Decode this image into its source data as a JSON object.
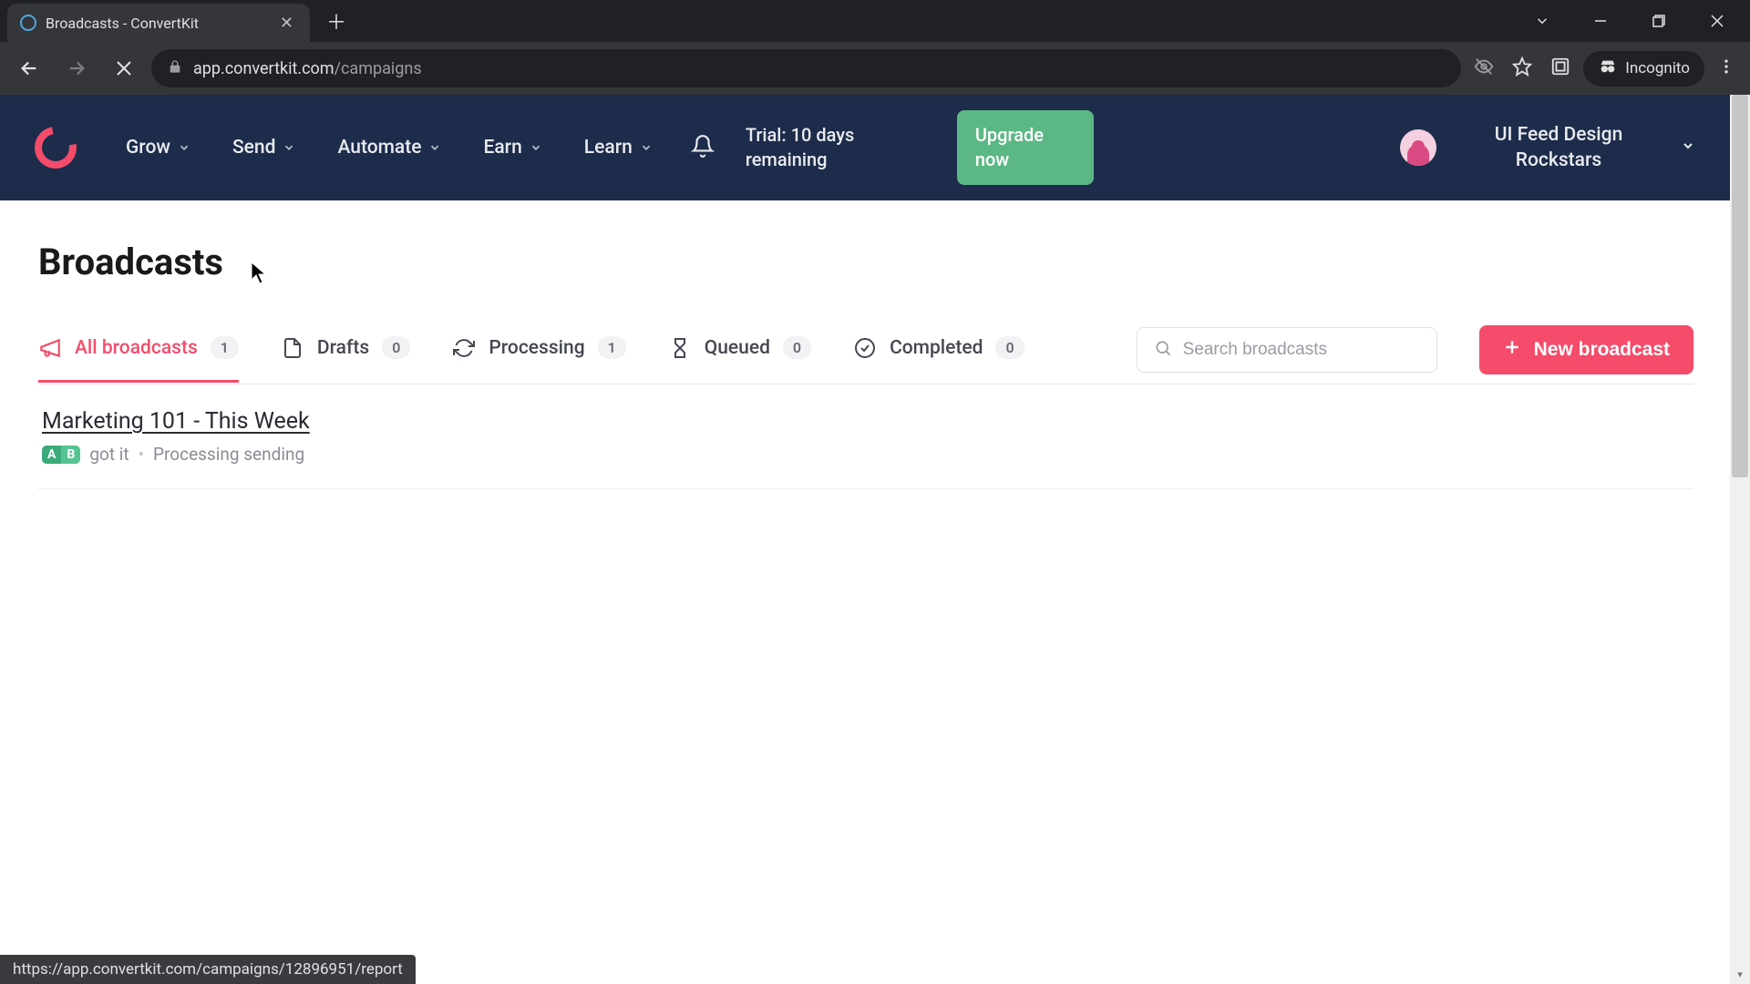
{
  "browser": {
    "tab_title": "Broadcasts - ConvertKit",
    "url_domain": "app.convertkit.com",
    "url_path": "/campaigns",
    "incognito_label": "Incognito",
    "status_url": "https://app.convertkit.com/campaigns/12896951/report"
  },
  "nav": {
    "items": [
      "Grow",
      "Send",
      "Automate",
      "Earn",
      "Learn"
    ],
    "trial": "Trial: 10 days remaining",
    "upgrade": "Upgrade now",
    "org": "UI Feed Design Rockstars"
  },
  "page": {
    "title": "Broadcasts"
  },
  "filters": {
    "all": {
      "label": "All broadcasts",
      "count": "1"
    },
    "drafts": {
      "label": "Drafts",
      "count": "0"
    },
    "processing": {
      "label": "Processing",
      "count": "1"
    },
    "queued": {
      "label": "Queued",
      "count": "0"
    },
    "completed": {
      "label": "Completed",
      "count": "0"
    }
  },
  "search": {
    "placeholder": "Search broadcasts"
  },
  "actions": {
    "new_broadcast": "New broadcast"
  },
  "rows": [
    {
      "title": "Marketing 101 - This Week",
      "badge_a": "A",
      "badge_b": "B",
      "preview": "got it",
      "status": "Processing sending"
    }
  ]
}
